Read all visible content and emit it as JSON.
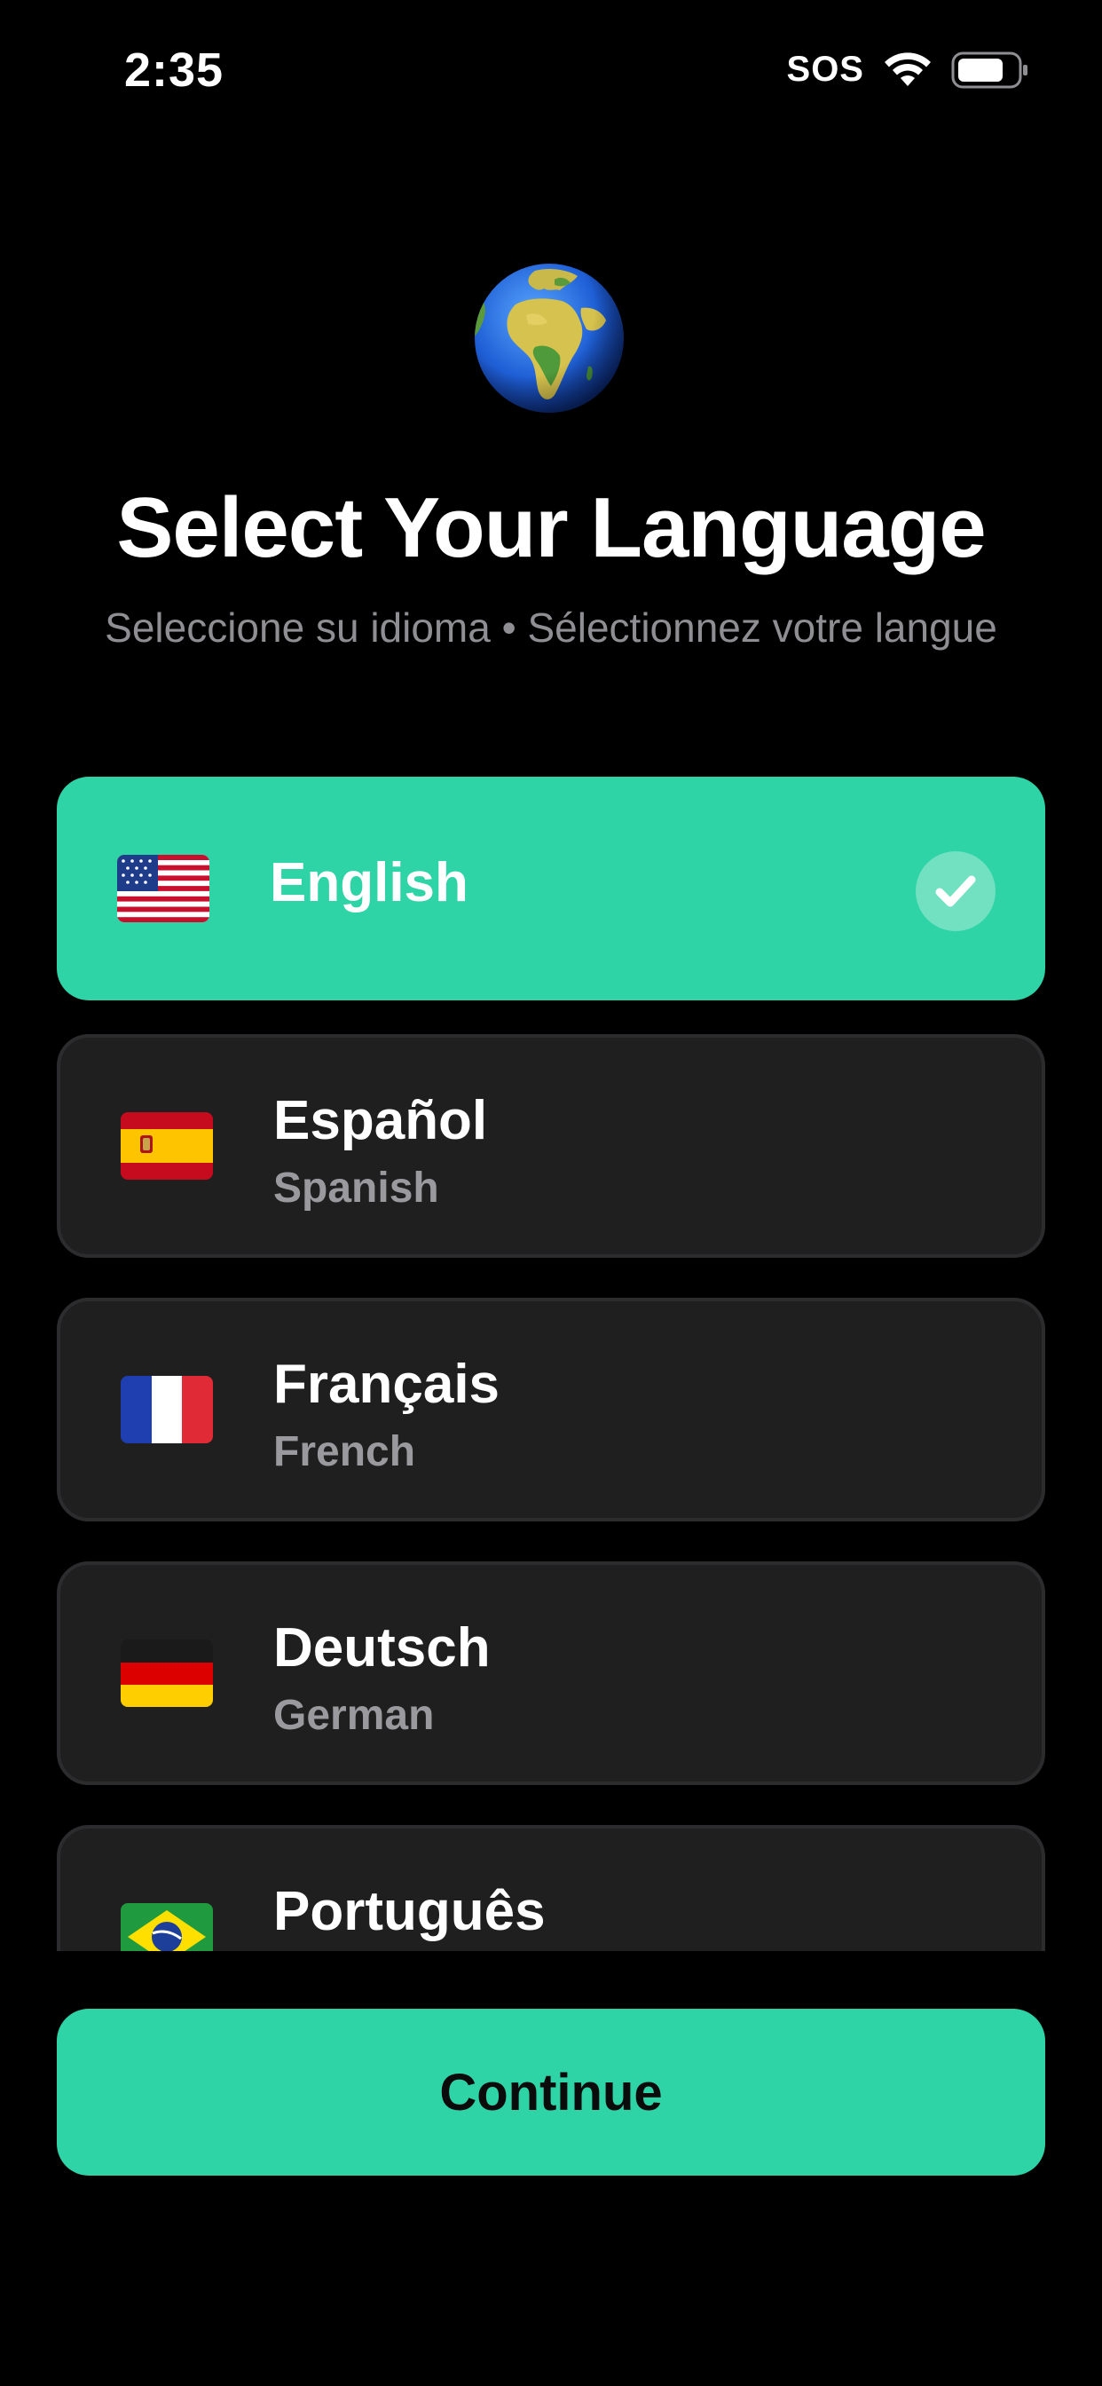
{
  "status_bar": {
    "time": "2:35",
    "sos": "SOS",
    "wifi_icon": "wifi-icon",
    "battery_icon": "battery-icon"
  },
  "header": {
    "icon": "globe-icon",
    "title": "Select Your Language",
    "subtitle": "Seleccione su idioma • Sélectionnez votre langue"
  },
  "languages": [
    {
      "native": "English",
      "english": "",
      "flag": "us-flag-icon",
      "selected": true
    },
    {
      "native": "Español",
      "english": "Spanish",
      "flag": "spain-flag-icon",
      "selected": false
    },
    {
      "native": "Français",
      "english": "French",
      "flag": "france-flag-icon",
      "selected": false
    },
    {
      "native": "Deutsch",
      "english": "German",
      "flag": "germany-flag-icon",
      "selected": false
    },
    {
      "native": "Português",
      "english": "",
      "flag": "brazil-flag-icon",
      "selected": false
    }
  ],
  "continue_button": {
    "label": "Continue"
  },
  "colors": {
    "background": "#000000",
    "accent": "#2ed3a6",
    "card": "#1f1f1f",
    "card_border": "#2c2c2e",
    "subtitle": "#8e8e93",
    "secondary_text": "#9a9a9e"
  }
}
